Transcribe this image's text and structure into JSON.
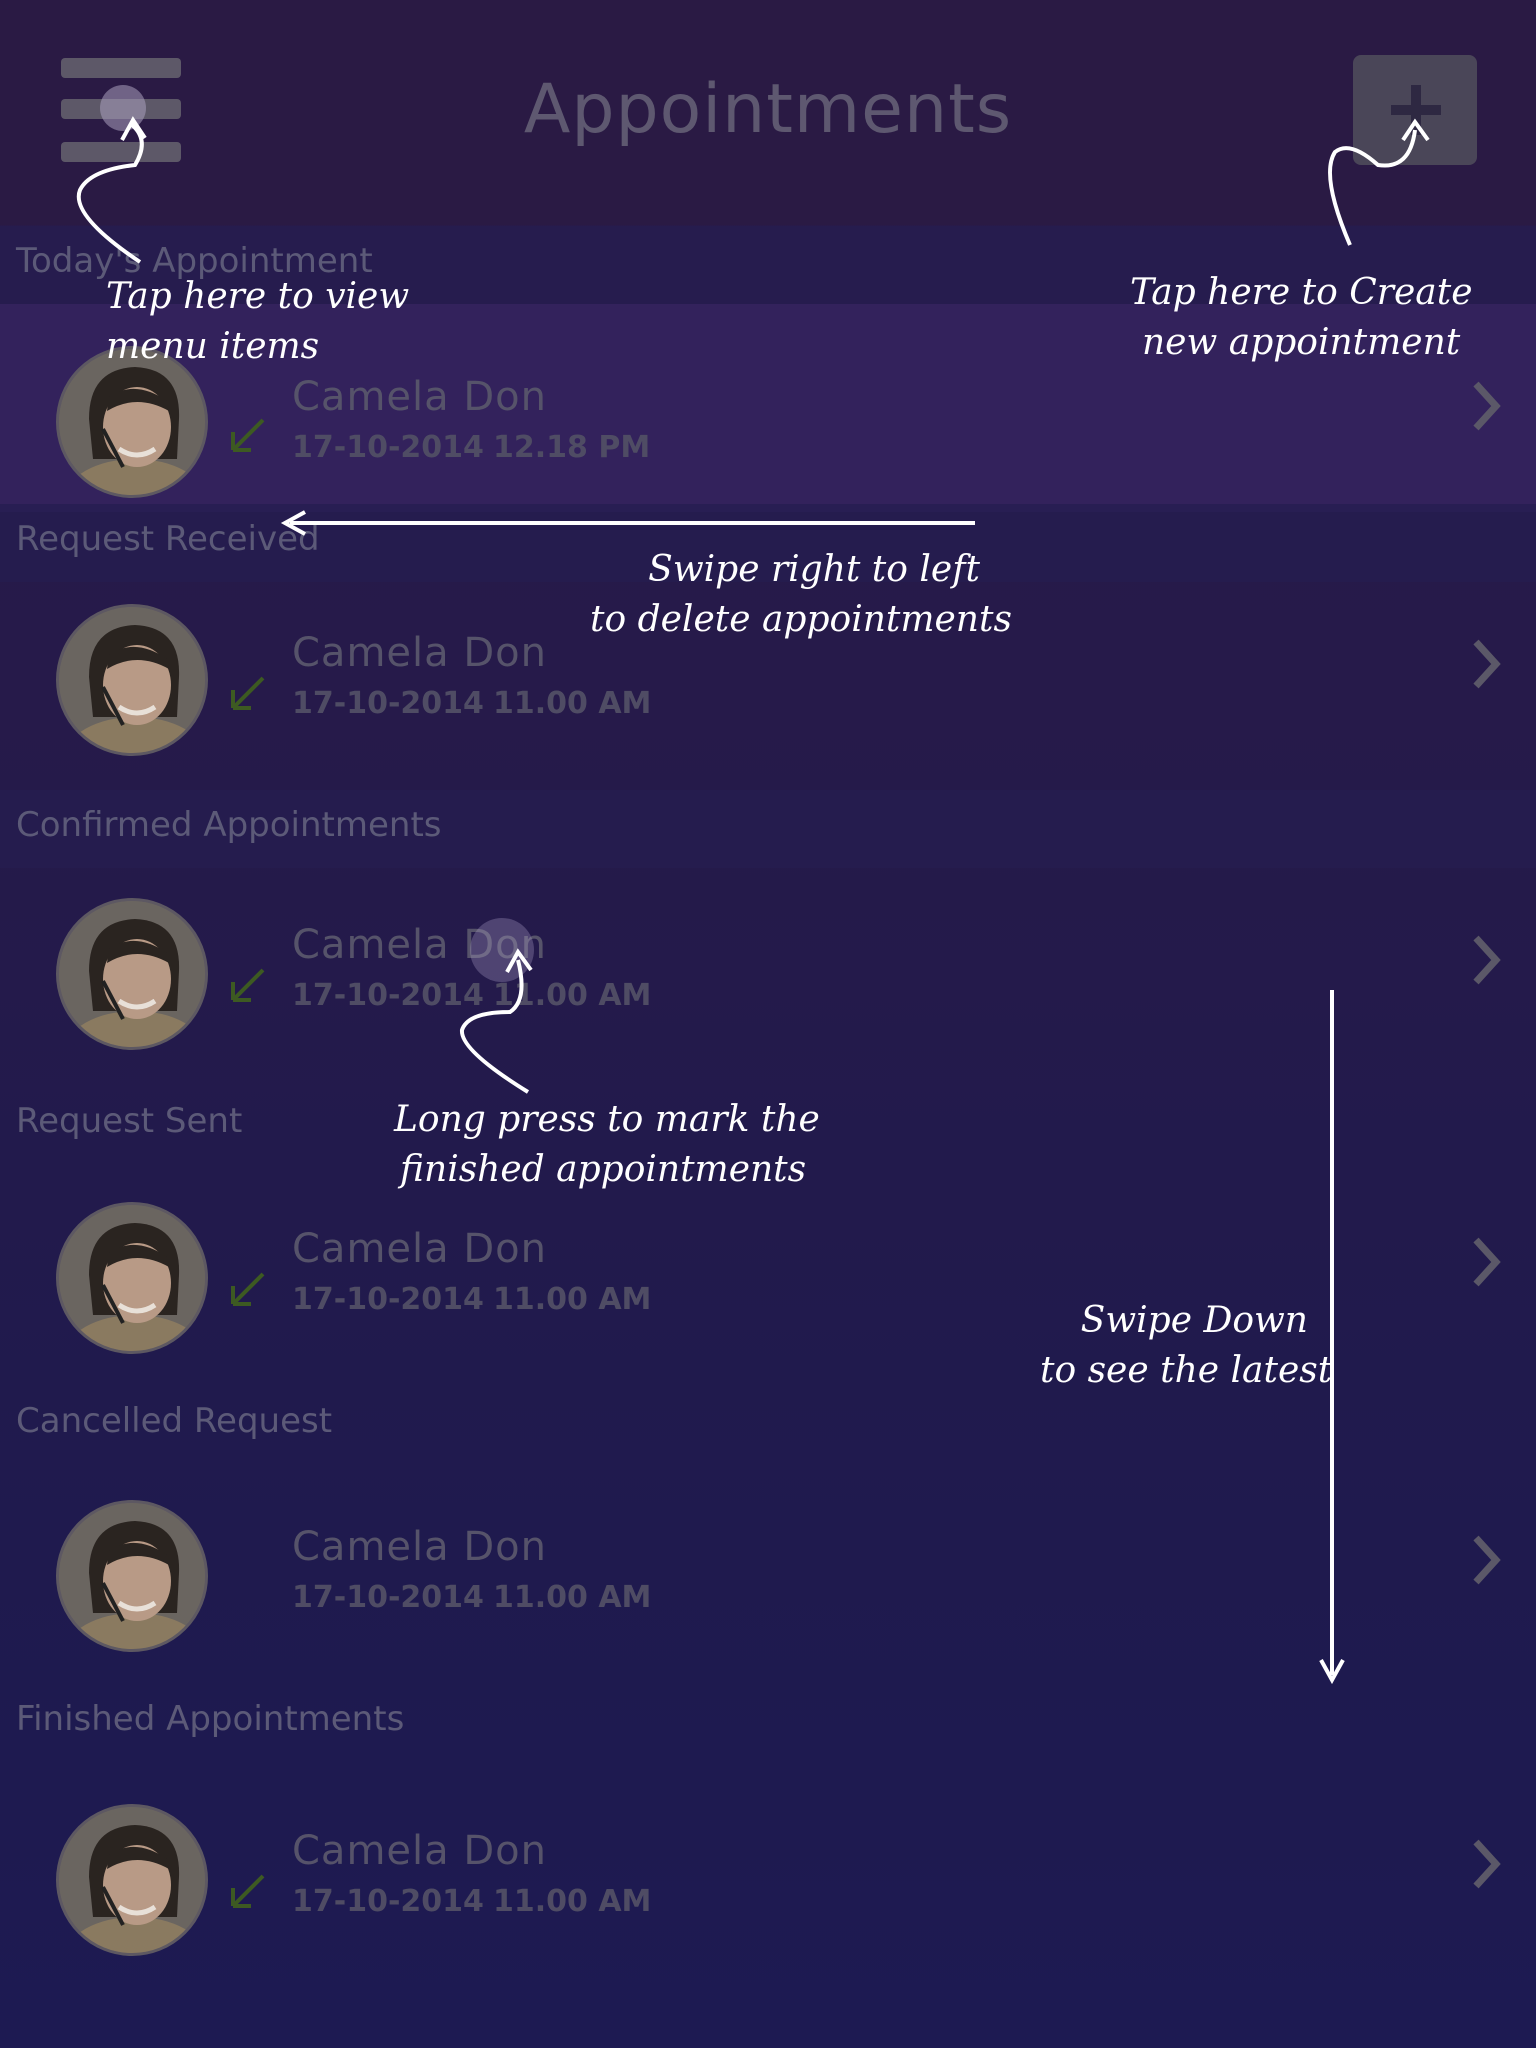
{
  "header": {
    "title": "Appointments",
    "menu_icon": "hamburger-menu-icon",
    "add_icon": "plus-icon"
  },
  "sections": [
    {
      "label": "Today's Appointment",
      "entry": {
        "name": "Camela Don",
        "date": "17-10-2014",
        "time": "12.18 PM",
        "checked": true
      }
    },
    {
      "label": "Request Received",
      "entry": {
        "name": "Camela Don",
        "date": "17-10-2014",
        "time": "11.00 AM",
        "checked": true
      }
    },
    {
      "label": "Confirmed Appointments",
      "entry": {
        "name": "Camela Don",
        "date": "17-10-2014",
        "time": "11.00 AM",
        "checked": true
      }
    },
    {
      "label": "Request Sent",
      "entry": {
        "name": "Camela Don",
        "date": "17-10-2014",
        "time": "11.00 AM",
        "checked": true
      }
    },
    {
      "label": "Cancelled Request",
      "entry": {
        "name": "Camela Don",
        "date": "17-10-2014",
        "time": "11.00 AM",
        "checked": false
      }
    },
    {
      "label": "Finished Appointments",
      "entry": {
        "name": "Camela Don",
        "date": "17-10-2014",
        "time": "11.00 AM",
        "checked": true
      }
    }
  ],
  "annotations": {
    "menu": [
      "Tap here to view",
      "menu items"
    ],
    "create": [
      "Tap here to Create",
      "new appointment"
    ],
    "swipe_delete": [
      "Swipe right to left",
      "to delete appointments"
    ],
    "long_press": [
      "Long press to mark the",
      "finished appointments"
    ],
    "swipe_down": [
      "Swipe Down",
      "to see the latest"
    ]
  },
  "colors": {
    "background": "#251a4a",
    "header": "#2a1a44",
    "today_row": "#33225c",
    "check": "#3d5a22",
    "annotation": "#ffffff"
  }
}
